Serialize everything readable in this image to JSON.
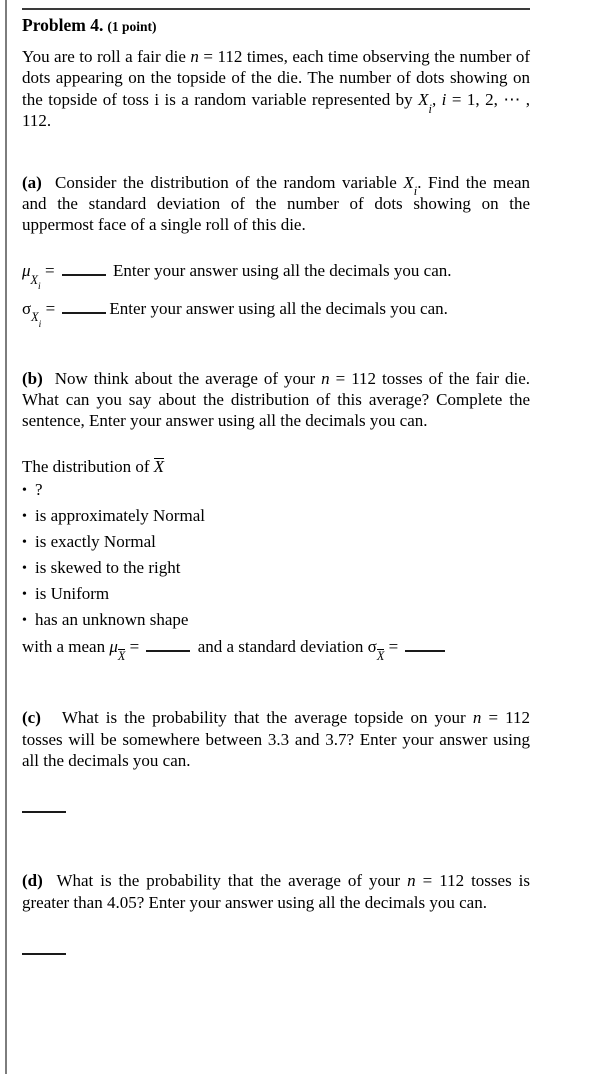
{
  "problem": {
    "title": "Problem 4.",
    "points": "(1 point)",
    "intro_line1": "You are to roll a fair die ",
    "intro_n_var": "n",
    "intro_eq": "=",
    "intro_n_value": "112",
    "intro_line1_cont": " times, each time observing the number of dots appearing on the topside of the die. The number of dots showing on the topside of toss i is a random variable represented by ",
    "intro_X": "X",
    "intro_X_sub": "i",
    "intro_tail": ", ",
    "intro_i": "i",
    "intro_i_eq": "=",
    "intro_i_list": "1, 2, ⋯ , 112."
  },
  "parts": {
    "a": {
      "label": "(a)",
      "text_1": "Consider the distribution of the random variable ",
      "var_X": "X",
      "var_X_sub": "i",
      "text_2": ". Find the mean and the standard deviation of the number of dots showing on the uppermost face of a single roll of this die.",
      "mu_symbol": "μ",
      "mu_sub_var": "X",
      "mu_sub_sub": "i",
      "mu_eq": "=",
      "mu_prompt": "Enter your answer using all the decimals you can.",
      "sigma_symbol": "σ",
      "sigma_sub_var": "X",
      "sigma_sub_sub": "i",
      "sigma_eq": "=",
      "sigma_prompt": "Enter your answer using all the decimals you can."
    },
    "b": {
      "label": "(b)",
      "text_1": "Now think about the average of your ",
      "n_var": "n",
      "n_eq": "=",
      "n_value": "112",
      "text_2": " tosses of the fair die. What can you say about the distribution of this average? Complete the sentence, Enter your answer using all the decimals you can.",
      "distribution_lead": "The distribution of ",
      "distribution_var": "X",
      "choices": [
        "?",
        "is approximately Normal",
        "is exactly Normal",
        "is skewed to the right",
        "is Uniform",
        "has an unknown shape"
      ],
      "bullet_glyph": "•",
      "with_mean_text": "with a mean ",
      "with_mean_mu": "μ",
      "with_mean_mu_sub": "X",
      "with_mean_eq": "=",
      "and_sd_text": " and a standard deviation ",
      "sd_sigma": "σ",
      "sd_sigma_sub": "X",
      "sd_eq": "="
    },
    "c": {
      "label": "(c)",
      "text_1": "What is the probability that the average topside on your ",
      "n_var": "n",
      "n_eq": "=",
      "n_value": "112",
      "text_2": " tosses will be somewhere between 3.3 and 3.7? Enter your answer using all the decimals you can."
    },
    "d": {
      "label": "(d)",
      "text_1": "What is the probability that the average of your ",
      "n_var": "n",
      "n_eq": "=",
      "n_value": "112",
      "text_2": " tosses is greater than 4.05? Enter your answer using all the decimals you can."
    }
  },
  "colors": {
    "text": "#000000",
    "rule": "#3a3a3a",
    "left_rule": "#7d7d7d",
    "blank": "#1a1a1a"
  }
}
